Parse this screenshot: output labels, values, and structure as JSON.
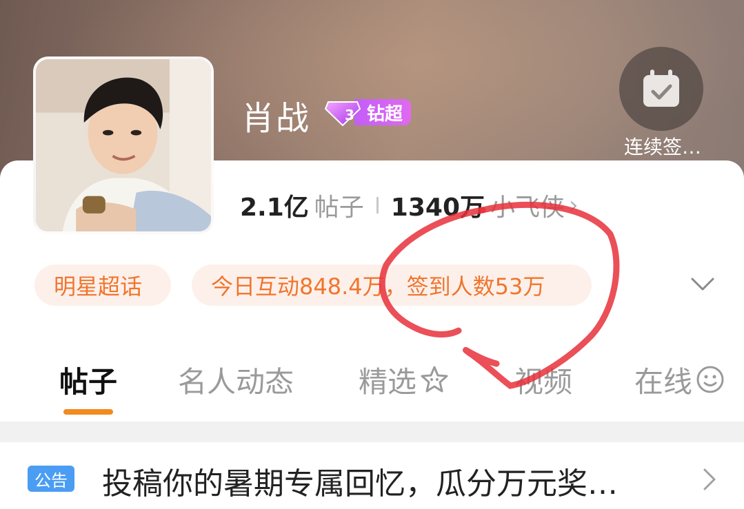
{
  "header": {
    "name": "肖战",
    "badge_label": "钻超",
    "badge_level": "3",
    "checkin_label": "连续签…"
  },
  "stats": {
    "posts_count": "2.1亿",
    "posts_label": "帖子",
    "fans_count": "1340万",
    "fans_label": "小飞侠",
    "chevron": "›"
  },
  "tags": {
    "category": "明星超话",
    "activity": "今日互动848.4万，签到人数53万"
  },
  "tabs": [
    {
      "label": "帖子"
    },
    {
      "label": "名人动态"
    },
    {
      "label": "精选"
    },
    {
      "label": "视频"
    },
    {
      "label": "在线"
    }
  ],
  "notice": {
    "tag": "公告",
    "text": "投稿你的暑期专属回忆，瓜分万元奖…"
  },
  "colors": {
    "accent": "#f28a1e",
    "pill_text": "#f0752d",
    "badge_purple": "#c35ef7",
    "notice_blue": "#4a9df3",
    "annotation_red": "#e8303a"
  }
}
